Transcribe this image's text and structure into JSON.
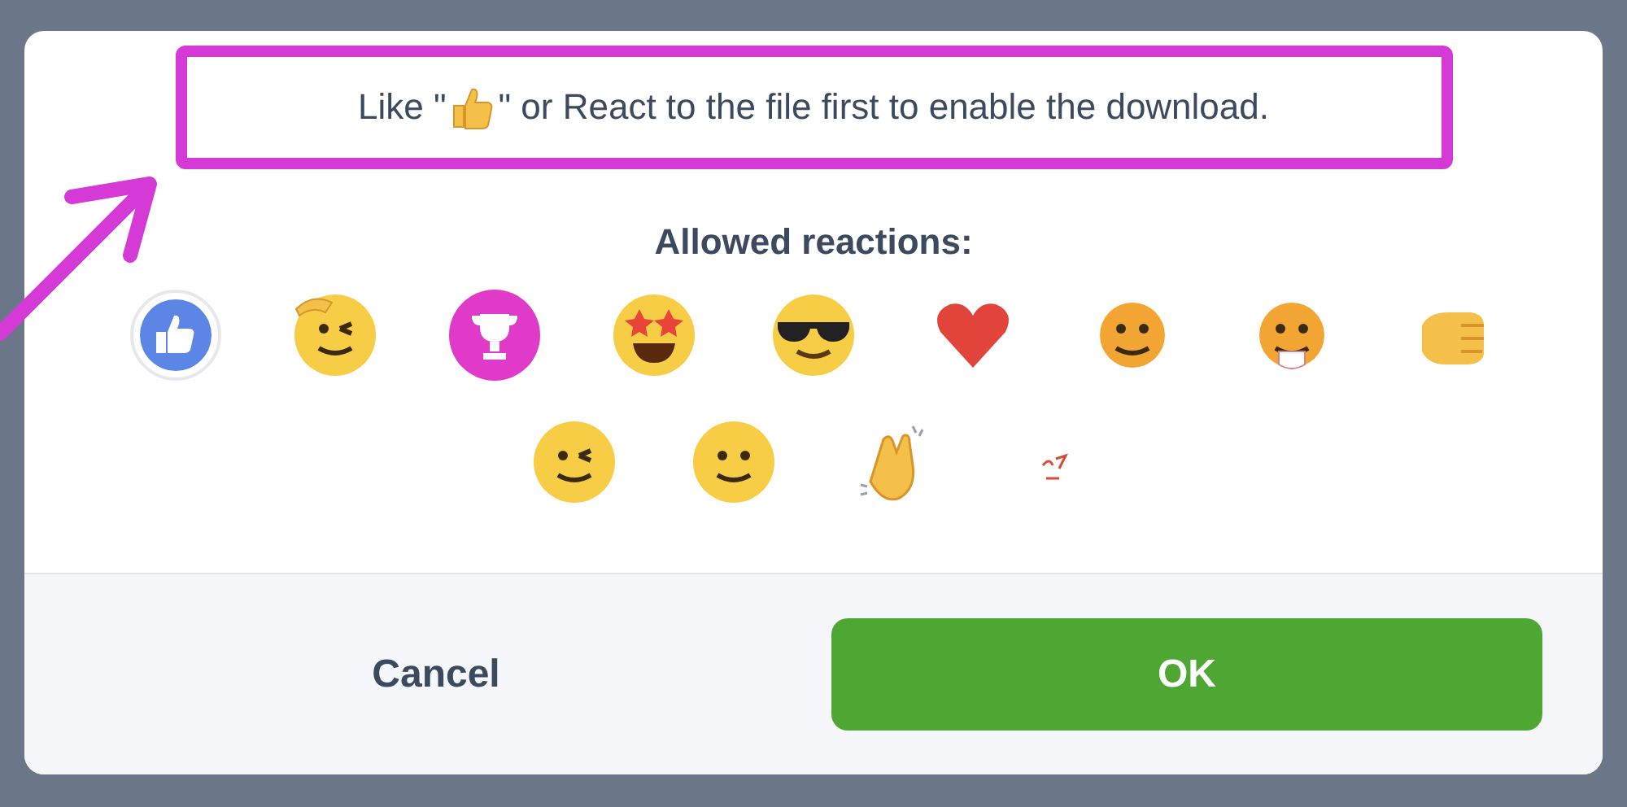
{
  "dialog": {
    "message_before": "Like \"",
    "message_after": "\" or React to the file first to enable the download.",
    "heading": "Allowed reactions:",
    "reactions": [
      {
        "kind": "like"
      },
      {
        "kind": "salute"
      },
      {
        "kind": "trophy"
      },
      {
        "kind": "star-eyes"
      },
      {
        "kind": "sunglasses"
      },
      {
        "kind": "heart"
      },
      {
        "kind": "happy"
      },
      {
        "kind": "coffee"
      },
      {
        "kind": "fist"
      },
      {
        "kind": "wink"
      },
      {
        "kind": "smile"
      },
      {
        "kind": "clap"
      },
      {
        "kind": "mark"
      }
    ],
    "buttons": [
      {
        "label": "Cancel",
        "kind": "secondary"
      },
      {
        "label": "OK",
        "kind": "primary"
      }
    ]
  }
}
